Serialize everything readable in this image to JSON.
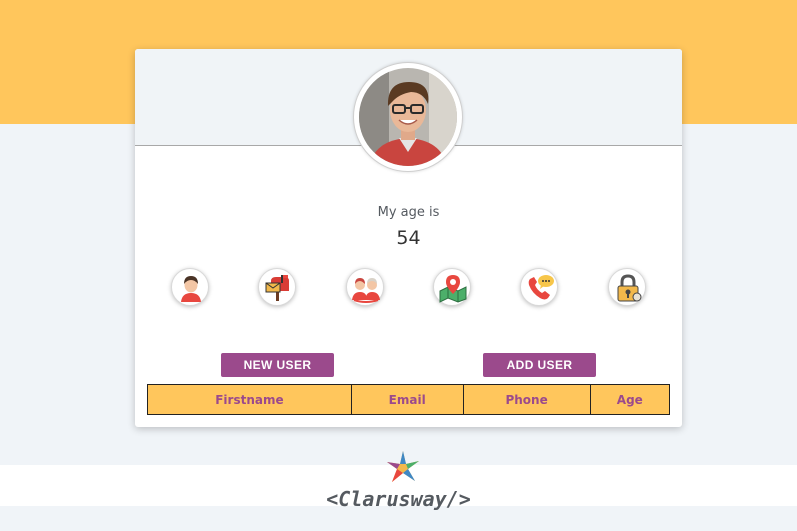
{
  "profile": {
    "age_label": "My age is",
    "age_value": "54"
  },
  "info_icons": [
    "user-icon",
    "mailbox-icon",
    "couple-icon",
    "map-location-icon",
    "phone-icon",
    "lock-icon"
  ],
  "buttons": {
    "new_user": "NEW USER",
    "add_user": "ADD USER"
  },
  "table": {
    "headers": [
      "Firstname",
      "Email",
      "Phone",
      "Age"
    ]
  },
  "footer": {
    "brand": "<Clarusway/>"
  },
  "colors": {
    "accent_yellow": "#ffc65c",
    "accent_purple": "#9b4a8c",
    "background": "#f0f4f8"
  }
}
